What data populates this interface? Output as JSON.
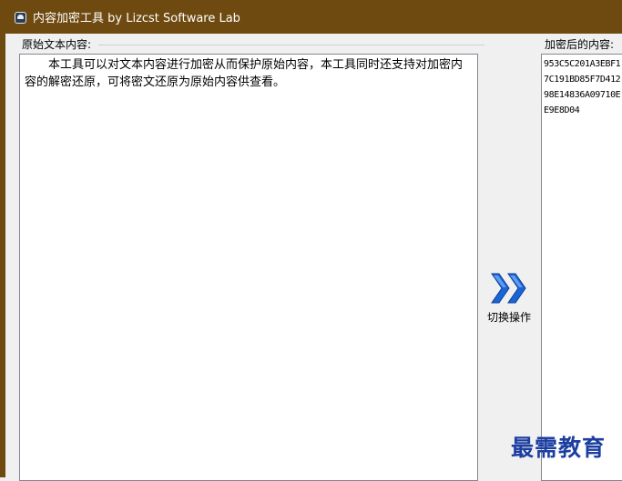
{
  "window": {
    "title": "内容加密工具  by Lizcst Software Lab",
    "icon": "lock-icon",
    "accent_color": "#6e4a10"
  },
  "original_panel": {
    "label": "原始文本内容:",
    "content": "本工具可以对文本内容进行加密从而保护原始内容，本工具同时还支持对加密内容的解密还原，可将密文还原为原始内容供查看。"
  },
  "switch_button": {
    "label": "切换操作",
    "icon": "double-chevron-right-icon",
    "color": "#1a64d6"
  },
  "encrypted_panel": {
    "label": "加密后的内容:",
    "lines": [
      "953C5C201A3EBF1",
      "7C191BD85F7D412",
      "98E14836A09710E",
      "E9E8D04"
    ]
  },
  "watermark": {
    "text": "最需教育",
    "color": "#1c3ea0"
  }
}
